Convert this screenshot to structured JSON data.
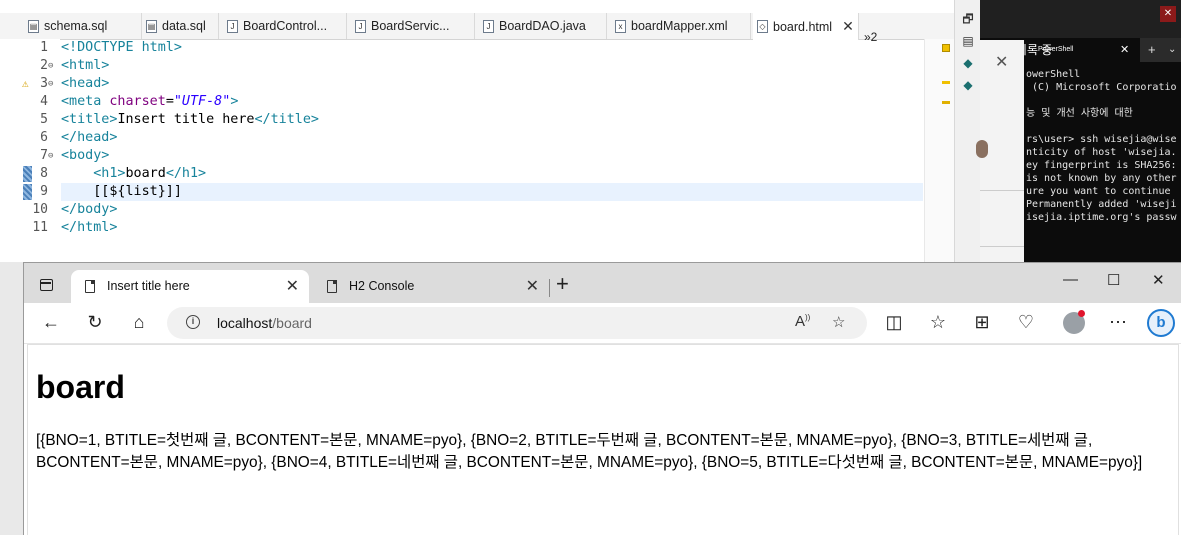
{
  "editor": {
    "tabs": [
      {
        "label": "schema.sql",
        "icon": "sql-file-icon"
      },
      {
        "label": "data.sql",
        "icon": "sql-file-icon"
      },
      {
        "label": "BoardControl...",
        "icon": "java-file-icon"
      },
      {
        "label": "BoardServic...",
        "icon": "java-file-icon"
      },
      {
        "label": "BoardDAO.java",
        "icon": "java-file-icon"
      },
      {
        "label": "boardMapper.xml",
        "icon": "xml-file-icon"
      },
      {
        "label": "board.html",
        "icon": "html-file-icon",
        "active": true
      }
    ],
    "overflow": "»2",
    "lines": [
      {
        "n": "1",
        "parts": [
          [
            "tg",
            "<!DOCTYPE html>"
          ]
        ]
      },
      {
        "n": "2",
        "fold": true,
        "parts": [
          [
            "tg",
            "<html>"
          ]
        ]
      },
      {
        "n": "3",
        "fold": true,
        "warn": true,
        "parts": [
          [
            "tg",
            "<head>"
          ]
        ]
      },
      {
        "n": "4",
        "parts": [
          [
            "tg",
            "<meta "
          ],
          [
            "at",
            "charset"
          ],
          [
            "tx",
            "="
          ],
          [
            "av",
            "\"UTF-8\""
          ],
          [
            "tg",
            ">"
          ]
        ]
      },
      {
        "n": "5",
        "parts": [
          [
            "tg",
            "<title>"
          ],
          [
            "tx",
            "Insert title here"
          ],
          [
            "tg",
            "</title>"
          ]
        ]
      },
      {
        "n": "6",
        "parts": [
          [
            "tg",
            "</head>"
          ]
        ]
      },
      {
        "n": "7",
        "fold": true,
        "parts": [
          [
            "tg",
            "<body>"
          ]
        ]
      },
      {
        "n": "8",
        "mark": true,
        "parts": [
          [
            "tx",
            "    "
          ],
          [
            "tg",
            "<h1>"
          ],
          [
            "tx",
            "board"
          ],
          [
            "tg",
            "</h1>"
          ]
        ]
      },
      {
        "n": "9",
        "mark": true,
        "highlight": true,
        "parts": [
          [
            "tx",
            "    [[${list}]]"
          ]
        ]
      },
      {
        "n": "10",
        "parts": [
          [
            "tg",
            "</body>"
          ]
        ]
      },
      {
        "n": "11",
        "parts": [
          [
            "tg",
            "</html>"
          ]
        ]
      }
    ]
  },
  "powershell": {
    "tab_title": "기록 중",
    "tab_sub": "PowerShell",
    "lines": [
      "owerShell",
      " (C) Microsoft Corporatio",
      "",
      "능 및 개선 사항에 대한 ",
      "",
      "rs\\user> ssh wisejia@wise",
      "nticity of host 'wisejia.",
      "ey fingerprint is SHA256:",
      "is not known by any other",
      "ure you want to continue ",
      "Permanently added 'wiseji",
      "isejia.iptime.org's passw"
    ]
  },
  "browser": {
    "tabs": [
      {
        "title": "Insert title here",
        "active": true
      },
      {
        "title": "H2 Console",
        "active": false
      }
    ],
    "url_host": "localhost",
    "url_path": "/board",
    "page": {
      "heading": "board",
      "list_text": "[{BNO=1, BTITLE=첫번째 글, BCONTENT=본문, MNAME=pyo}, {BNO=2, BTITLE=두번째 글, BCONTENT=본문, MNAME=pyo}, {BNO=3, BTITLE=세번째 글, BCONTENT=본문, MNAME=pyo}, {BNO=4, BTITLE=네번째 글, BCONTENT=본문, MNAME=pyo}, {BNO=5, BTITLE=다섯번째 글, BCONTENT=본문, MNAME=pyo}]"
    }
  }
}
